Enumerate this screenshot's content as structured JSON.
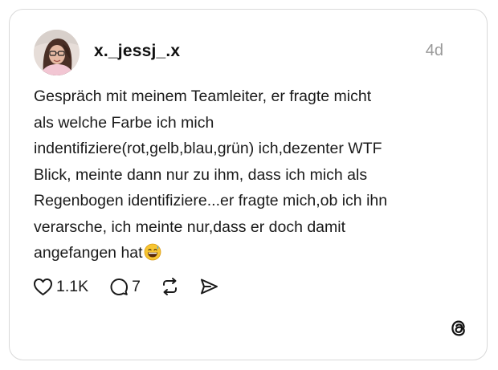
{
  "post": {
    "author": {
      "username": "x._jessj_.x",
      "avatar_icon": "profile-photo"
    },
    "timestamp": "4d",
    "text_lines": [
      "Gespräch mit meinem Teamleiter, er fragte micht",
      "als welche Farbe ich mich",
      "indentifiziere(rot,gelb,blau,grün) ich,dezenter WTF",
      "Blick, meinte dann nur zu ihm, dass ich mich als",
      "Regenbogen identifiziere...er fragte mich,ob ich ihn",
      "verarsche, ich meinte nur,dass er doch damit",
      "angefangen hat"
    ],
    "trailing_emoji": "grinning-face-with-sweat",
    "actions": {
      "likes": "1.1K",
      "replies": "7",
      "repost_icon": "repost-icon",
      "share_icon": "send-icon"
    },
    "brand_icon": "threads-logo-icon",
    "colors": {
      "text": "#1a1a1a",
      "muted": "#9a9a9a",
      "border": "#d9d9d9"
    }
  }
}
